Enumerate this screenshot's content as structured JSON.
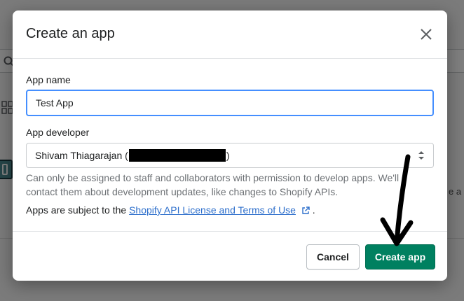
{
  "modal": {
    "title": "Create an app",
    "fields": {
      "app_name_label": "App name",
      "app_name_value": "Test App",
      "app_developer_label": "App developer",
      "app_developer_value_prefix": "Shivam Thiagarajan (",
      "app_developer_value_suffix": ")",
      "help_text": "Can only be assigned to staff and collaborators with permission to develop apps. We'll contact them about development updates, like changes to Shopify APIs.",
      "terms_prefix": "Apps are subject to the ",
      "terms_link": "Shopify API License and Terms of Use",
      "terms_suffix": " ."
    },
    "footer": {
      "cancel_label": "Cancel",
      "create_label": "Create app"
    }
  },
  "background": {
    "partial_text": "e a"
  },
  "icons": {
    "close": "close-icon",
    "select_caret": "select-caret-icon",
    "external_link": "external-link-icon",
    "search": "search-icon",
    "grid": "grid-icon",
    "annotation_arrow": "arrow-icon"
  },
  "colors": {
    "primary": "#008060",
    "link": "#2c6ecb",
    "focus_border": "#458fff",
    "overlay": "rgba(0,0,0,0.5)"
  }
}
